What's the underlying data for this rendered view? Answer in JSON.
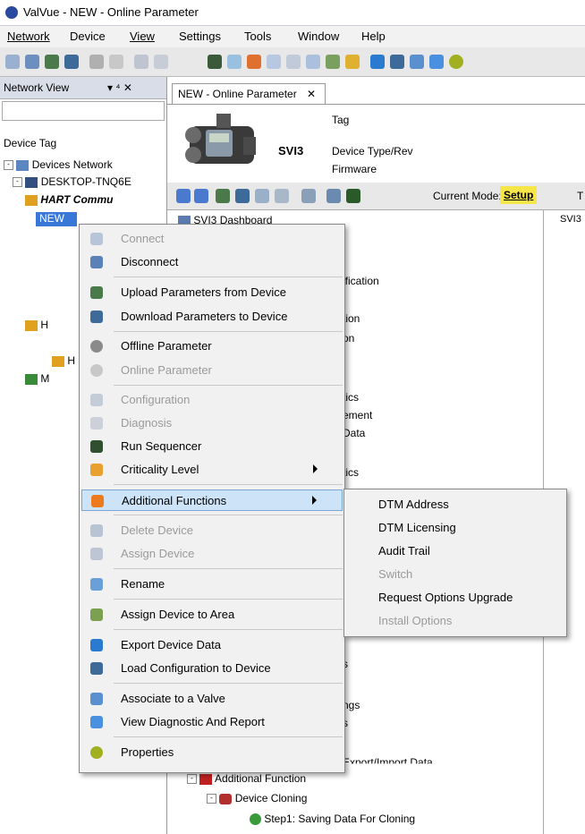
{
  "window": {
    "title": "ValVue - NEW      - Online Parameter"
  },
  "menubar": {
    "items": [
      "Network",
      "Device",
      "View",
      "Settings",
      "Tools",
      "Window",
      "Help"
    ]
  },
  "left_panel": {
    "header_title": "Network View",
    "pin": "▾ ⁴ ✕",
    "device_tag_label": "Device Tag",
    "tree": [
      "Devices Network",
      "DESKTOP-TNQ6E",
      "HART Commu",
      "NEW",
      "H",
      "H",
      "M"
    ]
  },
  "document_tab": {
    "label": "NEW      - Online Parameter",
    "close": "✕"
  },
  "device_header": {
    "model": "SVI3",
    "fields": [
      "Tag",
      "Device Type/Rev",
      "Firmware"
    ]
  },
  "toolbar2": {
    "mode_label": "Current Mode:",
    "mode_value": "Setup",
    "extra": "T"
  },
  "main_tree": {
    "nodes": [
      "SVI3 Dashboard",
      "ification",
      "tion",
      "on",
      "tics",
      "ement",
      "Data",
      "tics",
      "s",
      "ngs",
      "s",
      "Export/Import Data",
      "Additional Function",
      "Device Cloning",
      "Step1: Saving Data For Cloning"
    ],
    "right_strip_label": "SVI3"
  },
  "context_menu": {
    "items": [
      {
        "label": "Connect",
        "icon": "connect-icon",
        "enabled": false
      },
      {
        "label": "Disconnect",
        "icon": "disconnect-icon",
        "enabled": true
      },
      {
        "label": "Upload Parameters from Device",
        "icon": "upload-icon",
        "enabled": true
      },
      {
        "label": "Download Parameters to Device",
        "icon": "download-icon",
        "enabled": true
      },
      {
        "label": "Offline Parameter",
        "icon": "offline-parameter-icon",
        "enabled": true
      },
      {
        "label": "Online Parameter",
        "icon": "online-parameter-icon",
        "enabled": false
      },
      {
        "label": "Configuration",
        "icon": "configuration-icon",
        "enabled": false
      },
      {
        "label": "Diagnosis",
        "icon": "diagnosis-icon",
        "enabled": false
      },
      {
        "label": "Run Sequencer",
        "icon": "sequencer-icon",
        "enabled": true
      },
      {
        "label": "Criticality Level",
        "icon": "criticality-icon",
        "enabled": true,
        "submenu": true
      },
      {
        "label": "Additional Functions",
        "icon": "additional-functions-icon",
        "enabled": true,
        "submenu": true,
        "highlighted": true
      },
      {
        "label": "Delete Device",
        "icon": "delete-icon",
        "enabled": false
      },
      {
        "label": "Assign Device",
        "icon": "assign-icon",
        "enabled": false
      },
      {
        "label": "Rename",
        "icon": "rename-icon",
        "enabled": true
      },
      {
        "label": "Assign Device to Area",
        "icon": "area-icon",
        "enabled": true
      },
      {
        "label": "Export Device Data",
        "icon": "export-icon",
        "enabled": true
      },
      {
        "label": "Load Configuration to Device",
        "icon": "load-config-icon",
        "enabled": true
      },
      {
        "label": "Associate to a Valve",
        "icon": "valve-icon",
        "enabled": true
      },
      {
        "label": "View Diagnostic And Report",
        "icon": "report-icon",
        "enabled": true
      },
      {
        "label": "Properties",
        "icon": "properties-icon",
        "enabled": true
      }
    ]
  },
  "submenu": {
    "items": [
      {
        "label": "DTM Address",
        "enabled": true
      },
      {
        "label": "DTM Licensing",
        "enabled": true
      },
      {
        "label": "Audit Trail",
        "enabled": true
      },
      {
        "label": "Switch",
        "enabled": false
      },
      {
        "label": "Request Options Upgrade",
        "enabled": true
      },
      {
        "label": "Install Options",
        "enabled": false
      }
    ]
  },
  "colors": {
    "highlight": "#cde3f8",
    "mode_badge": "#f7e64a",
    "disabled_text": "#9a9a9a"
  }
}
